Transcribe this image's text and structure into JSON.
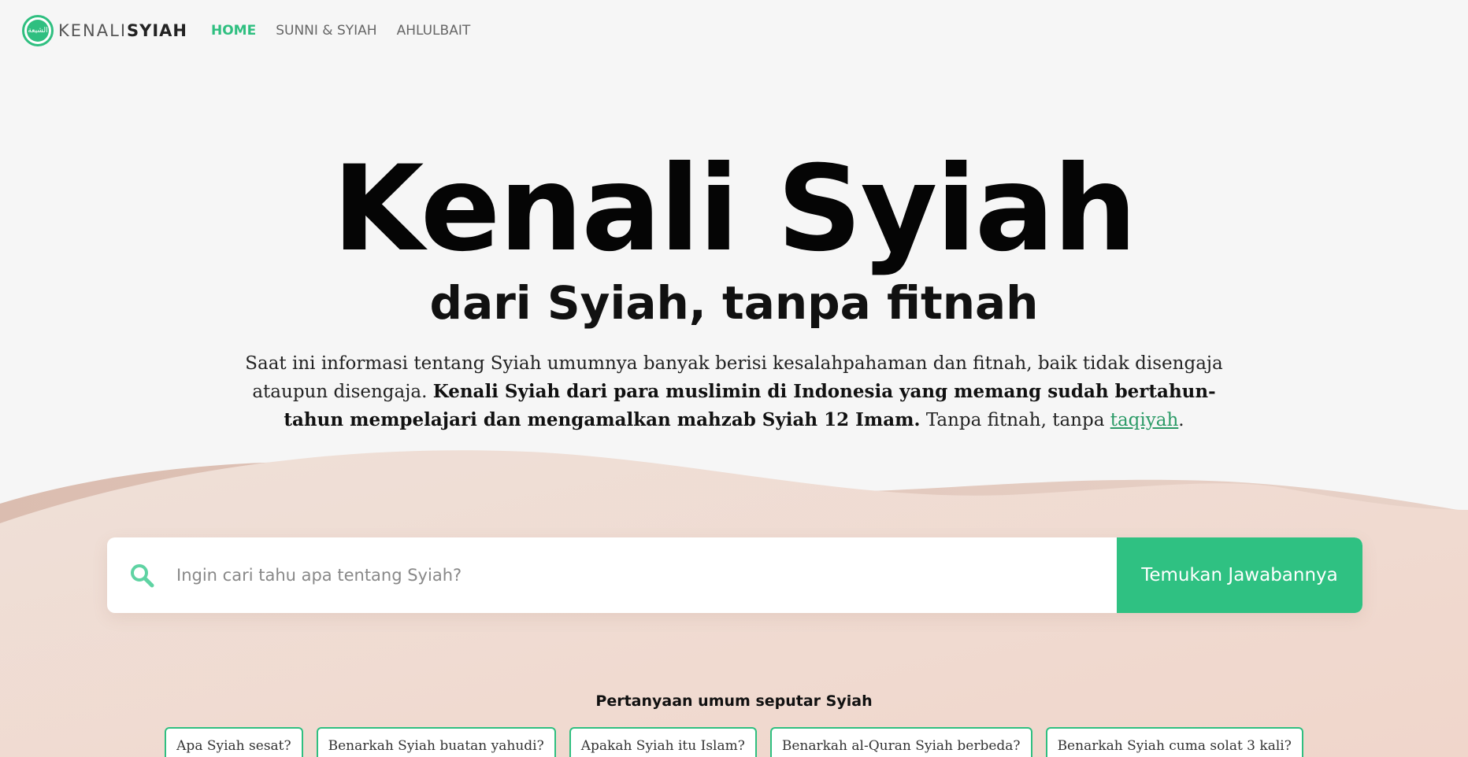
{
  "nav": {
    "logo": {
      "mark_text": "الشيعة",
      "text_part1": "KENALI",
      "text_part2": "SYIAH"
    },
    "links": [
      {
        "label": "HOME",
        "active": true
      },
      {
        "label": "SUNNI & SYIAH",
        "active": false
      },
      {
        "label": "AHLULBAIT",
        "active": false
      }
    ]
  },
  "hero": {
    "title": "Kenali Syiah",
    "subtitle": "dari Syiah, tanpa fitnah",
    "desc_part1": "Saat ini informasi tentang Syiah umumnya banyak berisi kesalahpahaman dan fitnah, baik tidak disengaja ataupun disengaja. ",
    "desc_bold": "Kenali Syiah dari para muslimin di Indonesia yang memang sudah bertahun-tahun mempelajari dan mengamalkan mahzab Syiah 12 Imam.",
    "desc_part2": " Tanpa fitnah, tanpa ",
    "desc_link": "taqiyah",
    "desc_end": "."
  },
  "search": {
    "placeholder": "Ingin cari tahu apa tentang Syiah?",
    "value": "",
    "button_label": "Temukan Jawabannya"
  },
  "faq": {
    "title": "Pertanyaan umum seputar Syiah",
    "chips": [
      "Apa Syiah sesat?",
      "Benarkah Syiah buatan yahudi?",
      "Apakah Syiah itu Islam?",
      "Benarkah al-Quran Syiah berbeda?",
      "Benarkah Syiah cuma solat 3 kali?"
    ]
  },
  "colors": {
    "accent": "#2fbf80",
    "button": "#2fc182",
    "background": "#f6f6f6",
    "dune_light": "#f0dcd2",
    "dune_dark": "#e2c4b6",
    "link": "#2a9a66"
  },
  "icons": {
    "search": "search-icon",
    "logo": "logo-icon"
  }
}
